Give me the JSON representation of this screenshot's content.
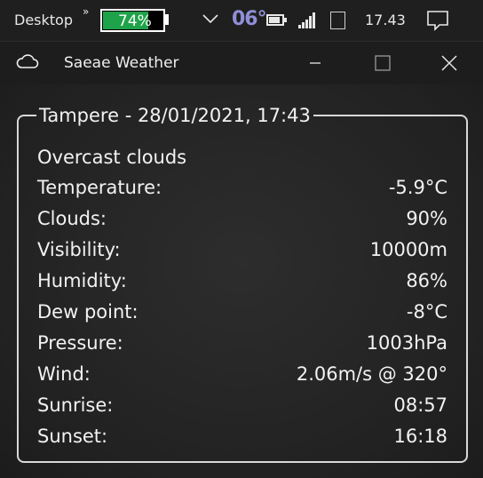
{
  "taskbar": {
    "desktop_label": "Desktop",
    "overflow_glyph": "»",
    "battery_percent_label": "74%",
    "battery_level": 0.74,
    "weather_temp": "06°",
    "clock": "17.43"
  },
  "window": {
    "title": "Saeae Weather"
  },
  "weather": {
    "header": "Tampere - 28/01/2021, 17:43",
    "description": "Overcast clouds",
    "rows": [
      {
        "label": "Temperature:",
        "value": "-5.9°C"
      },
      {
        "label": "Clouds:",
        "value": "90%"
      },
      {
        "label": "Visibility:",
        "value": "10000m"
      },
      {
        "label": "Humidity:",
        "value": "86%"
      },
      {
        "label": "Dew point:",
        "value": "-8°C"
      },
      {
        "label": "Pressure:",
        "value": "1003hPa"
      },
      {
        "label": "Wind:",
        "value": "2.06m/s @ 320°"
      },
      {
        "label": "Sunrise:",
        "value": "08:57"
      },
      {
        "label": "Sunset:",
        "value": "16:18"
      }
    ]
  },
  "colors": {
    "battery_green": "#1fa34a",
    "temp_purple": "#8f8fd8",
    "background": "#1d1d1d"
  }
}
